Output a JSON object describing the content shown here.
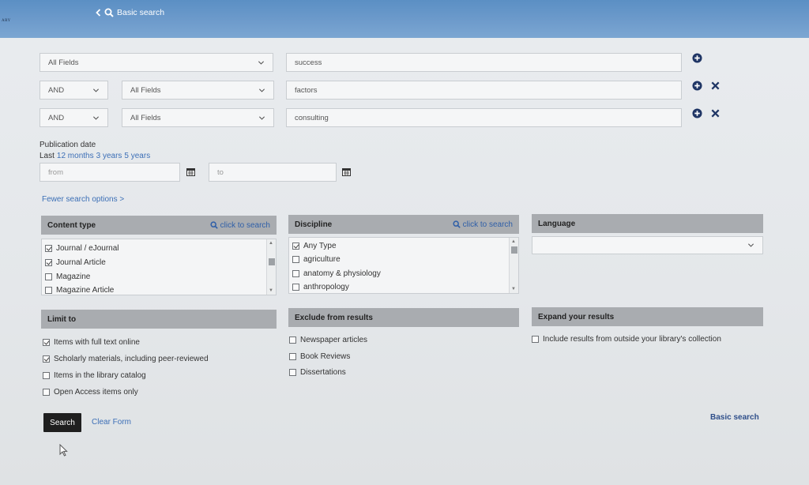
{
  "header": {
    "brand_text": "ARY",
    "back_label": "Basic search"
  },
  "search_rows": [
    {
      "field": "All Fields",
      "value": "success"
    },
    {
      "operator": "AND",
      "field": "All Fields",
      "value": "factors"
    },
    {
      "operator": "AND",
      "field": "All Fields",
      "value": "consulting"
    }
  ],
  "publication_date": {
    "label": "Publication date",
    "last_label": "Last",
    "ranges": [
      "12 months",
      "3 years",
      "5 years"
    ],
    "from_placeholder": "from",
    "to_placeholder": "to"
  },
  "fewer_options_label": "Fewer search options >",
  "content_type": {
    "title": "Content type",
    "search_label": "click to search",
    "items": [
      {
        "label": "Journal / eJournal",
        "checked": true
      },
      {
        "label": "Journal Article",
        "checked": true
      },
      {
        "label": "Magazine",
        "checked": false
      },
      {
        "label": "Magazine Article",
        "checked": false
      }
    ]
  },
  "discipline": {
    "title": "Discipline",
    "search_label": "click to search",
    "items": [
      {
        "label": "Any Type",
        "checked": true
      },
      {
        "label": "agriculture",
        "checked": false
      },
      {
        "label": "anatomy & physiology",
        "checked": false
      },
      {
        "label": "anthropology",
        "checked": false
      }
    ]
  },
  "language": {
    "title": "Language",
    "selected": ""
  },
  "limit_to": {
    "title": "Limit to",
    "items": [
      {
        "label": "Items with full text online",
        "checked": true
      },
      {
        "label": "Scholarly materials, including peer-reviewed",
        "checked": true
      },
      {
        "label": "Items in the library catalog",
        "checked": false
      },
      {
        "label": "Open Access items only",
        "checked": false
      }
    ]
  },
  "exclude": {
    "title": "Exclude from results",
    "items": [
      {
        "label": "Newspaper articles",
        "checked": false
      },
      {
        "label": "Book Reviews",
        "checked": false
      },
      {
        "label": "Dissertations",
        "checked": false
      }
    ]
  },
  "expand": {
    "title": "Expand your results",
    "items": [
      {
        "label": "Include results from outside your library's collection",
        "checked": false
      }
    ]
  },
  "actions": {
    "search_label": "Search",
    "clear_label": "Clear Form",
    "basic_search_label": "Basic search"
  },
  "colors": {
    "header_blue": "#6f9ccc",
    "link_blue": "#3c6fb6",
    "icon_navy": "#1f3565",
    "panel_gray": "#a9acb0"
  }
}
